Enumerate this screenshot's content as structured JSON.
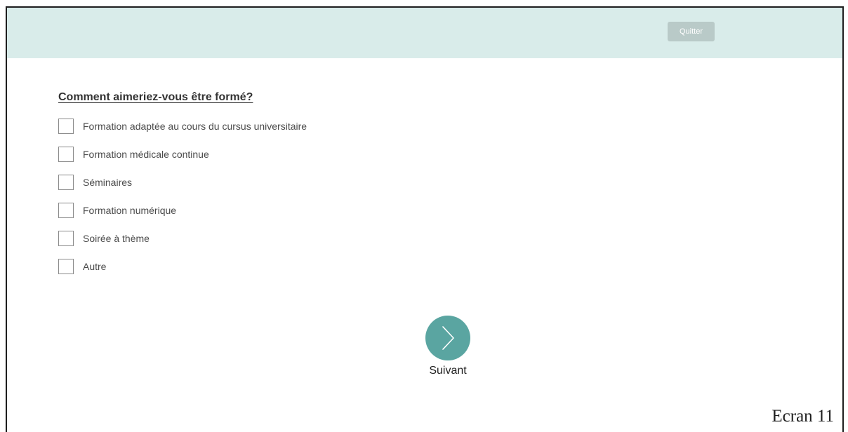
{
  "header": {
    "quit_label": "Quitter"
  },
  "question": {
    "title": "Comment aimeriez-vous être formé?",
    "options": [
      {
        "label": "Formation adaptée au cours du cursus universitaire",
        "checked": false
      },
      {
        "label": "Formation médicale continue",
        "checked": false
      },
      {
        "label": "Séminaires",
        "checked": false
      },
      {
        "label": "Formation numérique",
        "checked": false
      },
      {
        "label": "Soirée à thème",
        "checked": false
      },
      {
        "label": "Autre",
        "checked": false
      }
    ]
  },
  "navigation": {
    "next_label": "Suivant",
    "next_icon": "chevron-right-icon"
  },
  "screen": {
    "label": "Ecran 11"
  },
  "colors": {
    "header_background": "#d9ecea",
    "quit_button": "#b9cac8",
    "accent": "#5aa5a1"
  }
}
